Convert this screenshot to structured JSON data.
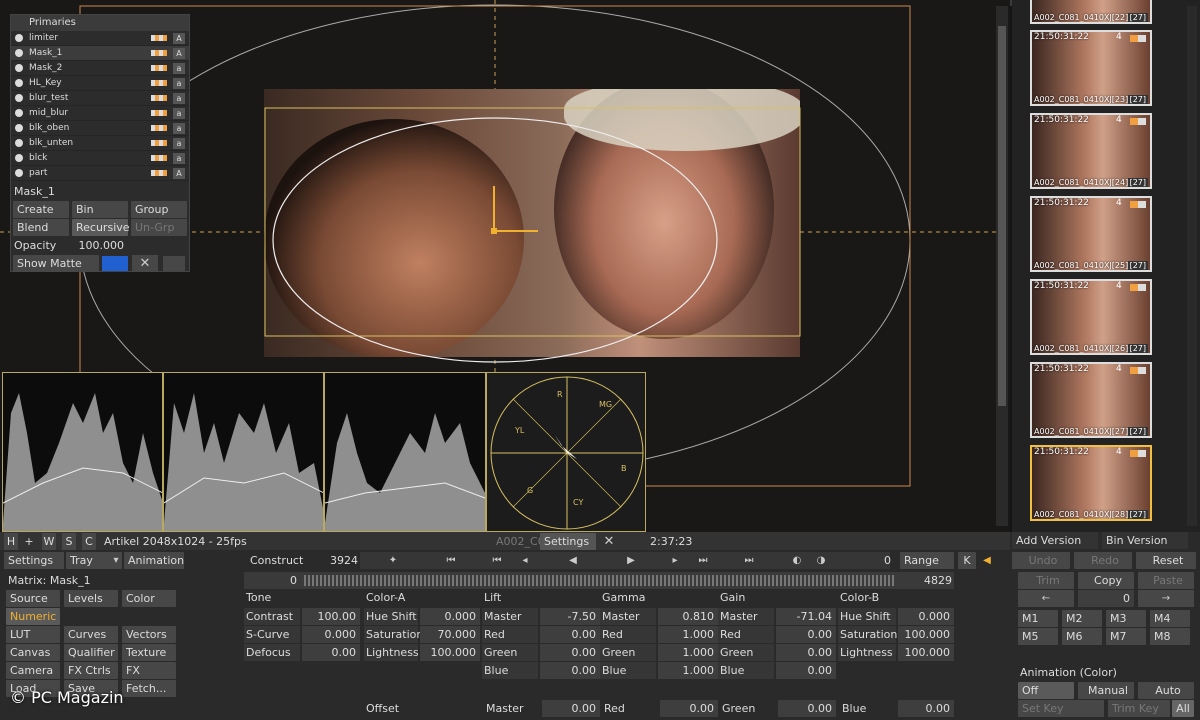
{
  "mask_panel": {
    "header": "Primaries",
    "masks": [
      {
        "name": "limiter",
        "flag": "A"
      },
      {
        "name": "Mask_1",
        "flag": "A"
      },
      {
        "name": "Mask_2",
        "flag": "a"
      },
      {
        "name": "HL_Key",
        "flag": "a"
      },
      {
        "name": "blur_test",
        "flag": "a"
      },
      {
        "name": "mid_blur",
        "flag": "a"
      },
      {
        "name": "blk_oben",
        "flag": "a"
      },
      {
        "name": "blk_unten",
        "flag": "a"
      },
      {
        "name": "blck",
        "flag": "a"
      },
      {
        "name": "part",
        "flag": "A"
      }
    ],
    "selected_name": "Mask_1",
    "create": "Create",
    "bin": "Bin",
    "group": "Group",
    "blend": "Blend",
    "recursive": "Recursive",
    "un_grp": "Un-Grp",
    "opacity_label": "Opacity",
    "opacity_value": "100.000",
    "show_matte": "Show Matte"
  },
  "viewer_bar": {
    "tabs": [
      "H",
      "+",
      "W",
      "S",
      "C"
    ],
    "format": "Artikel 2048x1024 - 25fps",
    "clip": "A002_C0",
    "settings": "Settings",
    "timecode": "2:37:23"
  },
  "thumbnails": [
    {
      "tc": "",
      "clip": "A002_C081_0410XJ[22]",
      "num": "[27]"
    },
    {
      "tc": "21:50:31:22",
      "clip": "A002_C081_0410XJ[23]",
      "num": "[27]"
    },
    {
      "tc": "21:50:31:22",
      "clip": "A002_C081_0410XJ[24]",
      "num": "[27]"
    },
    {
      "tc": "21:50:31:22",
      "clip": "A002_C081_0410XJ[25]",
      "num": "[27]"
    },
    {
      "tc": "21:50:31:22",
      "clip": "A002_C081_0410XJ[26]",
      "num": "[27]"
    },
    {
      "tc": "21:50:31:22",
      "clip": "A002_C081_0410XJ[27]",
      "num": "[27]"
    },
    {
      "tc": "21:50:31:22",
      "clip": "A002_C081_0410XJ[28]",
      "num": "[27]"
    }
  ],
  "thumb_badge": "4",
  "version": {
    "add": "Add Version",
    "bin": "Bin Version"
  },
  "toolbar": {
    "settings": "Settings",
    "tray": "Tray",
    "animation": "Animation",
    "construct": "Construct",
    "construct_value": "3924",
    "range_start": "0",
    "range": "Range",
    "k": "K",
    "undo": "Undo",
    "redo": "Redo",
    "reset": "Reset",
    "timeline_start": "0",
    "timeline_end": "4829"
  },
  "matrix": {
    "label": "Matrix: Mask_1",
    "menu": [
      [
        "Source",
        "Levels",
        "Color"
      ],
      [
        "Numeric",
        "",
        ""
      ],
      [
        "LUT",
        "Curves",
        "Vectors"
      ],
      [
        "Canvas",
        "Qualifier",
        "Texture"
      ],
      [
        "Camera",
        "FX Ctrls",
        "FX Inputs"
      ],
      [
        "Load",
        "Save",
        "Fetch..."
      ]
    ]
  },
  "tone": {
    "header": "Tone",
    "rows": [
      [
        "Contrast",
        "100.00"
      ],
      [
        "S-Curve",
        "0.000"
      ],
      [
        "Defocus",
        "0.00"
      ]
    ]
  },
  "color_a": {
    "header": "Color-A",
    "rows": [
      [
        "Hue Shift",
        "0.000"
      ],
      [
        "Saturation",
        "70.000"
      ],
      [
        "Lightness",
        "100.000"
      ]
    ]
  },
  "lift": {
    "header": "Lift",
    "rows": [
      [
        "Master",
        "-7.50"
      ],
      [
        "Red",
        "0.00"
      ],
      [
        "Green",
        "0.00"
      ],
      [
        "Blue",
        "0.00"
      ]
    ]
  },
  "gamma": {
    "header": "Gamma",
    "rows": [
      [
        "Master",
        "0.810"
      ],
      [
        "Red",
        "1.000"
      ],
      [
        "Green",
        "1.000"
      ],
      [
        "Blue",
        "1.000"
      ]
    ]
  },
  "gain": {
    "header": "Gain",
    "rows": [
      [
        "Master",
        "-71.04"
      ],
      [
        "Red",
        "0.00"
      ],
      [
        "Green",
        "0.00"
      ],
      [
        "Blue",
        "0.00"
      ]
    ]
  },
  "color_b": {
    "header": "Color-B",
    "rows": [
      [
        "Hue Shift",
        "0.000"
      ],
      [
        "Saturation",
        "100.000"
      ],
      [
        "Lightness",
        "100.000"
      ]
    ]
  },
  "offset": {
    "label": "Offset",
    "master": "Master",
    "master_v": "0.00",
    "red": "Red",
    "red_v": "0.00",
    "green": "Green",
    "green_v": "0.00",
    "blue": "Blue",
    "blue_v": "0.00"
  },
  "edit": {
    "trim": "Trim",
    "copy": "Copy",
    "paste": "Paste",
    "nav_value": "0",
    "memories": [
      "M1",
      "M2",
      "M3",
      "M4",
      "M5",
      "M6",
      "M7",
      "M8"
    ]
  },
  "anim_color": {
    "title": "Animation (Color)",
    "off": "Off",
    "manual": "Manual",
    "auto": "Auto",
    "set_key": "Set Key",
    "trim_key": "Trim Key",
    "all": "All"
  },
  "watermark": "© PC Magazin",
  "vectorscope": {
    "labels": [
      "YL",
      "MG",
      "R",
      "B",
      "CY",
      "G"
    ]
  }
}
